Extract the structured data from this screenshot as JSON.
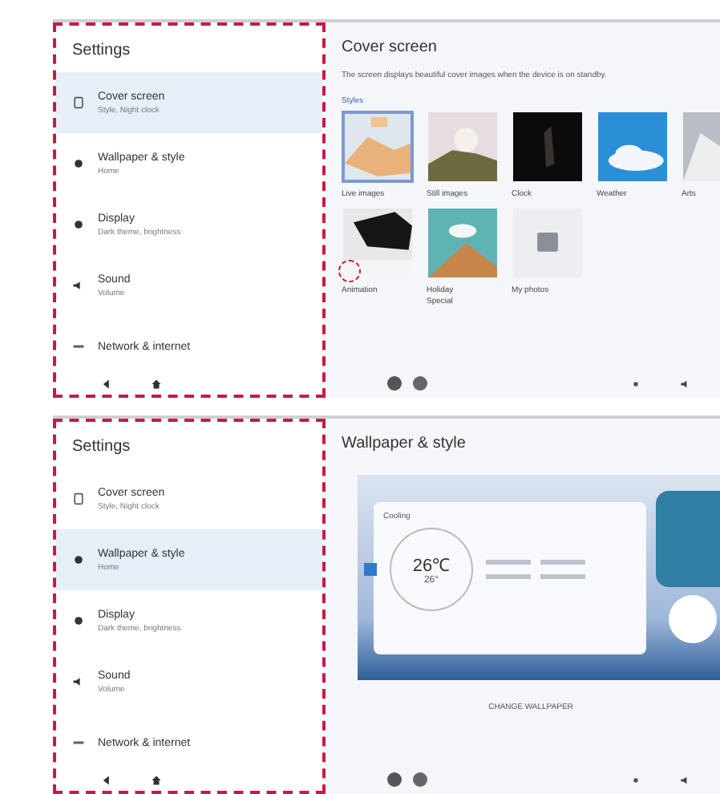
{
  "screens": [
    {
      "sidebar": {
        "title": "Settings",
        "outlined": true,
        "items": [
          {
            "label": "Cover screen",
            "sub": "Style, Night clock",
            "selected": true
          },
          {
            "label": "Wallpaper & style",
            "sub": "Home",
            "selected": false
          },
          {
            "label": "Display",
            "sub": "Dark theme, brightness",
            "selected": false
          },
          {
            "label": "Sound",
            "sub": "Volume",
            "selected": false
          },
          {
            "label": "Network & internet",
            "selected": false
          }
        ]
      },
      "content": {
        "kind": "cover",
        "title": "Cover screen",
        "description": "The screen displays beautiful cover images when the device is on standby.",
        "section": "Styles",
        "tiles": [
          {
            "label": "Live images",
            "selected": true,
            "circled": false
          },
          {
            "label": "Still images",
            "selected": false,
            "circled": false
          },
          {
            "label": "Clock",
            "selected": false,
            "circled": false
          },
          {
            "label": "Weather",
            "selected": false,
            "circled": false
          },
          {
            "label": "Arts",
            "selected": false,
            "circled": false
          },
          {
            "label": "Animation",
            "selected": false,
            "circled": true
          },
          {
            "label": "Holiday Special",
            "selected": false,
            "circled": false
          },
          {
            "label": "My photos",
            "selected": false,
            "circled": false
          }
        ]
      }
    },
    {
      "sidebar": {
        "title": "Settings",
        "outlined": true,
        "items": [
          {
            "label": "Cover screen",
            "sub": "Style, Night clock",
            "selected": false
          },
          {
            "label": "Wallpaper & style",
            "sub": "Home",
            "selected": true
          },
          {
            "label": "Display",
            "sub": "Dark theme, brightness",
            "selected": false
          },
          {
            "label": "Sound",
            "sub": "Volume",
            "selected": false
          },
          {
            "label": "Network & internet",
            "selected": false
          }
        ]
      },
      "content": {
        "kind": "wallpaper",
        "title": "Wallpaper & style",
        "preview": {
          "mode": "Cooling",
          "temperature": "26℃",
          "target": "26°"
        },
        "button": "CHANGE WALLPAPER"
      }
    }
  ]
}
